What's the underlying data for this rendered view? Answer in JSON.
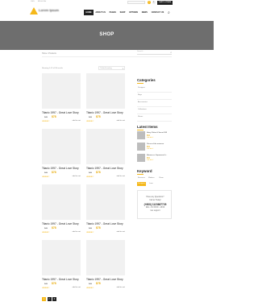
{
  "topbar": {
    "currency": "USD",
    "lang": "ENGLISH",
    "search_placeholder": "",
    "counts": [
      "0",
      "2"
    ],
    "cart_label": "CART 0 ITEMS"
  },
  "header": {
    "logo_text": "Lorem Ipsum",
    "nav": [
      "HOME",
      "ABOUT US",
      "PAGES",
      "SHOP",
      "OPTIONS",
      "NEWS",
      "CONTACT US"
    ]
  },
  "hero": {
    "title": "SHOP"
  },
  "breadcrumb": "Home / Products",
  "sidebar_search_placeholder": "Search...",
  "listing": {
    "result_count": "Showing 1-12 of 36 results",
    "sort_label": "Default sorting"
  },
  "products": [
    {
      "name": "Titanic 1997 - Great Love Story",
      "old_price": "$40",
      "price": "$78",
      "stars": "★★★★☆",
      "cart": "add to cart"
    },
    {
      "name": "Titanic 1997 - Great Love Story",
      "old_price": "$40",
      "price": "$78",
      "stars": "★★★★☆",
      "cart": "add to cart"
    },
    {
      "name": "Titanic 1997 - Great Love Story",
      "old_price": "$40",
      "price": "$78",
      "stars": "★★★★☆",
      "cart": "add to cart"
    },
    {
      "name": "Titanic 1997 - Great Love Story",
      "old_price": "$40",
      "price": "$78",
      "stars": "★★★★☆",
      "cart": "add to cart"
    },
    {
      "name": "Titanic 1997 - Great Love Story",
      "old_price": "$40",
      "price": "$78",
      "stars": "★★★★☆",
      "cart": "add to cart"
    },
    {
      "name": "Titanic 1997 - Great Love Story",
      "old_price": "$40",
      "price": "$78",
      "stars": "★★★★☆",
      "cart": "add to cart"
    },
    {
      "name": "Titanic 1997 - Great Love Story",
      "old_price": "$40",
      "price": "$78",
      "stars": "★★★★☆",
      "cart": "add to cart"
    },
    {
      "name": "Titanic 1997 - Great Love Story",
      "old_price": "$40",
      "price": "$78",
      "stars": "★★★★☆",
      "cart": "add to cart"
    }
  ],
  "pagination": [
    "1",
    "2",
    "3"
  ],
  "sidebar": {
    "categories_title": "Categories",
    "categories": [
      "Designer",
      "Bags",
      "Accessories",
      "Collections",
      "Shoes"
    ],
    "latest_title": "Latest Items",
    "latest": [
      {
        "title": "Harry Potter & Secret Will",
        "price": "$54",
        "stars": "★★★★☆"
      },
      {
        "title": "Prince of the universe",
        "price": "$54",
        "stars": "★★★★☆"
      },
      {
        "title": "Batman vs Superman th...",
        "price": "$54",
        "stars": "★★★★☆"
      }
    ],
    "keyword_title": "Keyword",
    "tags": [
      "Business",
      "Modern",
      "Clean",
      "Designer",
      "Love"
    ],
    "contact": {
      "question": "Have any Questions?",
      "call": "Call us Today!",
      "phone": "(+800) 1123667729",
      "hours": "Mon - Fri 09:00 - 18:00",
      "support": "Get support"
    }
  },
  "colors": {
    "accent": "#f5b81a",
    "hero": "#6e6e6e",
    "dark": "#222222"
  }
}
